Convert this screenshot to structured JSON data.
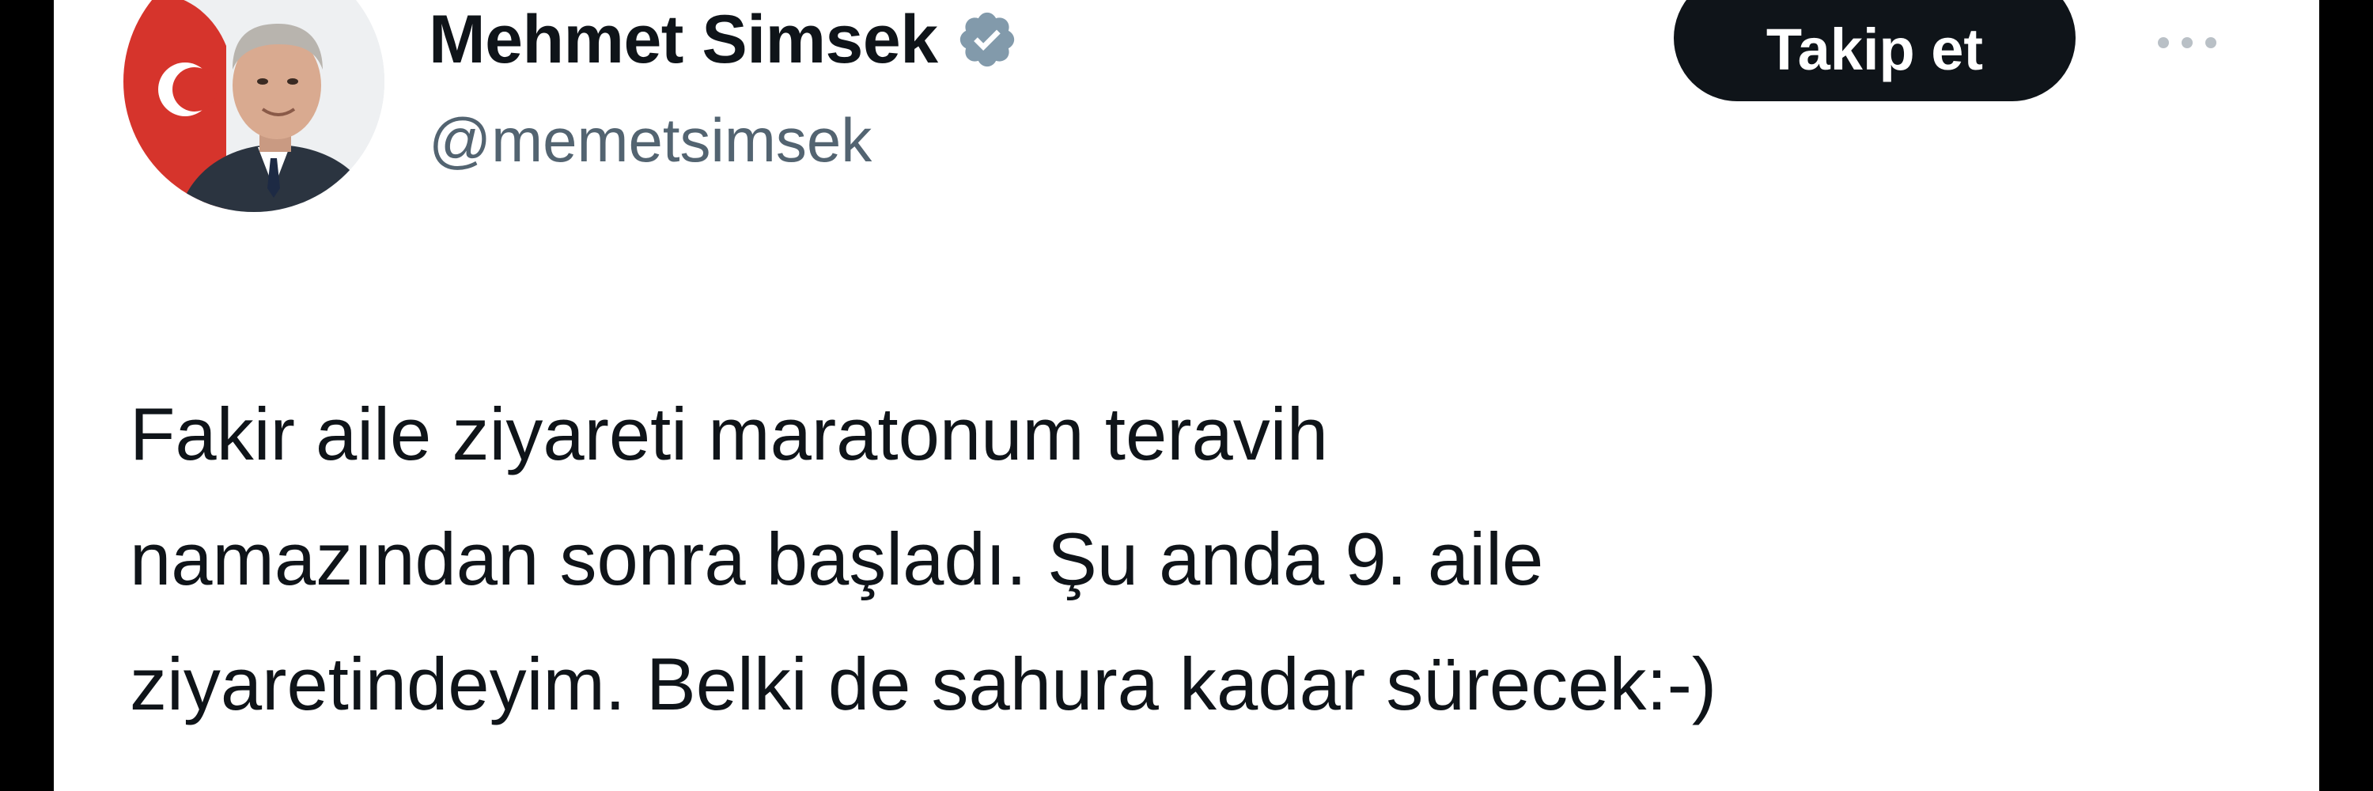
{
  "author": {
    "display_name": "Mehmet Simsek",
    "handle": "@memetsimsek",
    "verified_icon": "verified-badge-icon",
    "avatar_icon": "profile-photo"
  },
  "actions": {
    "follow_label": "Takip et",
    "more_icon": "more-options-icon"
  },
  "tweet": {
    "lines": [
      "Fakir aile ziyareti maratonum teravih",
      "namazından sonra başladı. Şu anda 9. aile",
      "ziyaretindeyim. Belki de sahura kadar sürecek:-)"
    ]
  },
  "colors": {
    "text_primary": "#0f1419",
    "text_secondary": "#536471",
    "follow_button_bg": "#0f1419",
    "verified_badge": "#829aab",
    "frame": "#000000",
    "card_bg": "#ffffff"
  }
}
